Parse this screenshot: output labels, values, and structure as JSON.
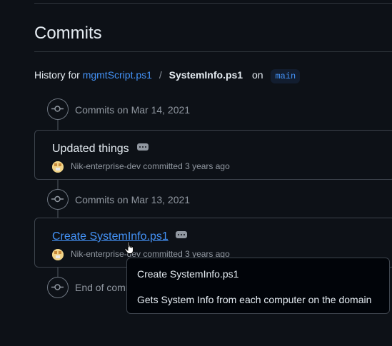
{
  "page": {
    "title": "Commits"
  },
  "history": {
    "prefix": "History for",
    "repo": "mgmtScript.ps1",
    "separator": "/",
    "file": "SystemInfo.ps1",
    "on": "on",
    "branch": "main"
  },
  "groups": [
    {
      "label": "Commits on Mar 14, 2021",
      "commits": [
        {
          "title": "Updated things",
          "author": "Nik-enterprise-dev",
          "action": "committed 3 years ago"
        }
      ]
    },
    {
      "label": "Commits on Mar 13, 2021",
      "commits": [
        {
          "title": "Create SystemInfo.ps1",
          "author": "Nik-enterprise-dev",
          "action": "committed 3 years ago"
        }
      ]
    }
  ],
  "end_label": "End of commit history for this file",
  "tooltip": {
    "title": "Create SystemInfo.ps1",
    "description": "Gets System Info from each computer on the domain"
  },
  "colors": {
    "background": "#0d1117",
    "link": "#4493f8",
    "muted": "#9198a1",
    "border": "#3d444d"
  },
  "icons": [
    "git-commit-icon",
    "kebab-horizontal-icon",
    "user-avatar",
    "pointer-cursor-icon"
  ]
}
